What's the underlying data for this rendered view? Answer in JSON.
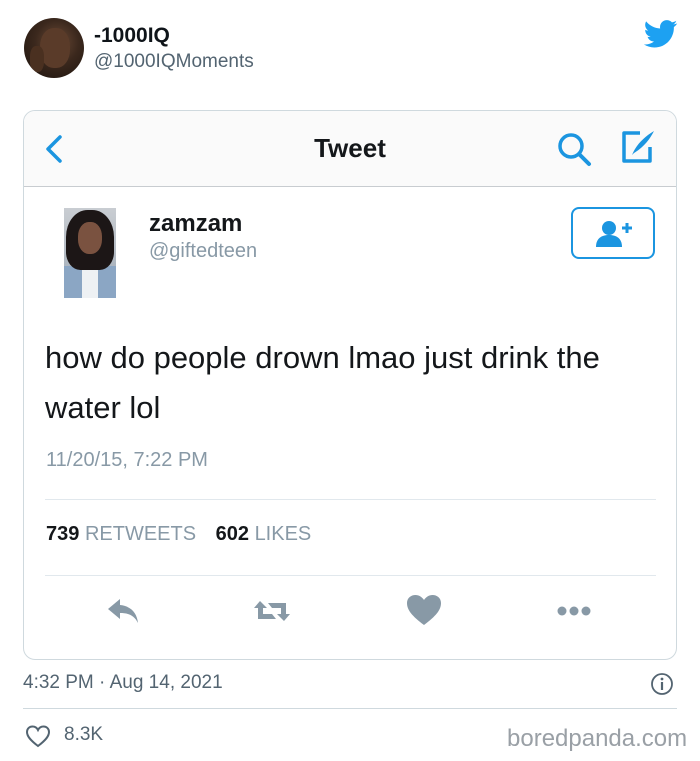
{
  "outer": {
    "display_name": "-1000IQ",
    "handle": "@1000IQMoments",
    "time": "4:32 PM · Aug 14, 2021",
    "like_count": "8.3K",
    "watermark": "boredpanda.com"
  },
  "card": {
    "nav_title": "Tweet",
    "author_name": "zamzam",
    "author_handle": "@giftedteen",
    "text": "how do people drown lmao just drink the water lol",
    "date": "11/20/15, 7:22 PM",
    "retweet_count": "739",
    "retweet_label": "RETWEETS",
    "like_count": "602",
    "like_label": "LIKES"
  },
  "icons": {
    "brand": "twitter-bird-icon",
    "back": "chevron-left-icon",
    "search": "search-icon",
    "compose": "compose-icon",
    "follow": "add-user-icon",
    "reply": "reply-icon",
    "retweet": "retweet-icon",
    "like": "heart-icon",
    "more": "more-icon",
    "info": "info-icon"
  },
  "colors": {
    "twitter_blue": "#1da1f2",
    "card_blue": "#1b95e0",
    "icon_gray": "#8899a6",
    "text_gray": "#536471"
  }
}
